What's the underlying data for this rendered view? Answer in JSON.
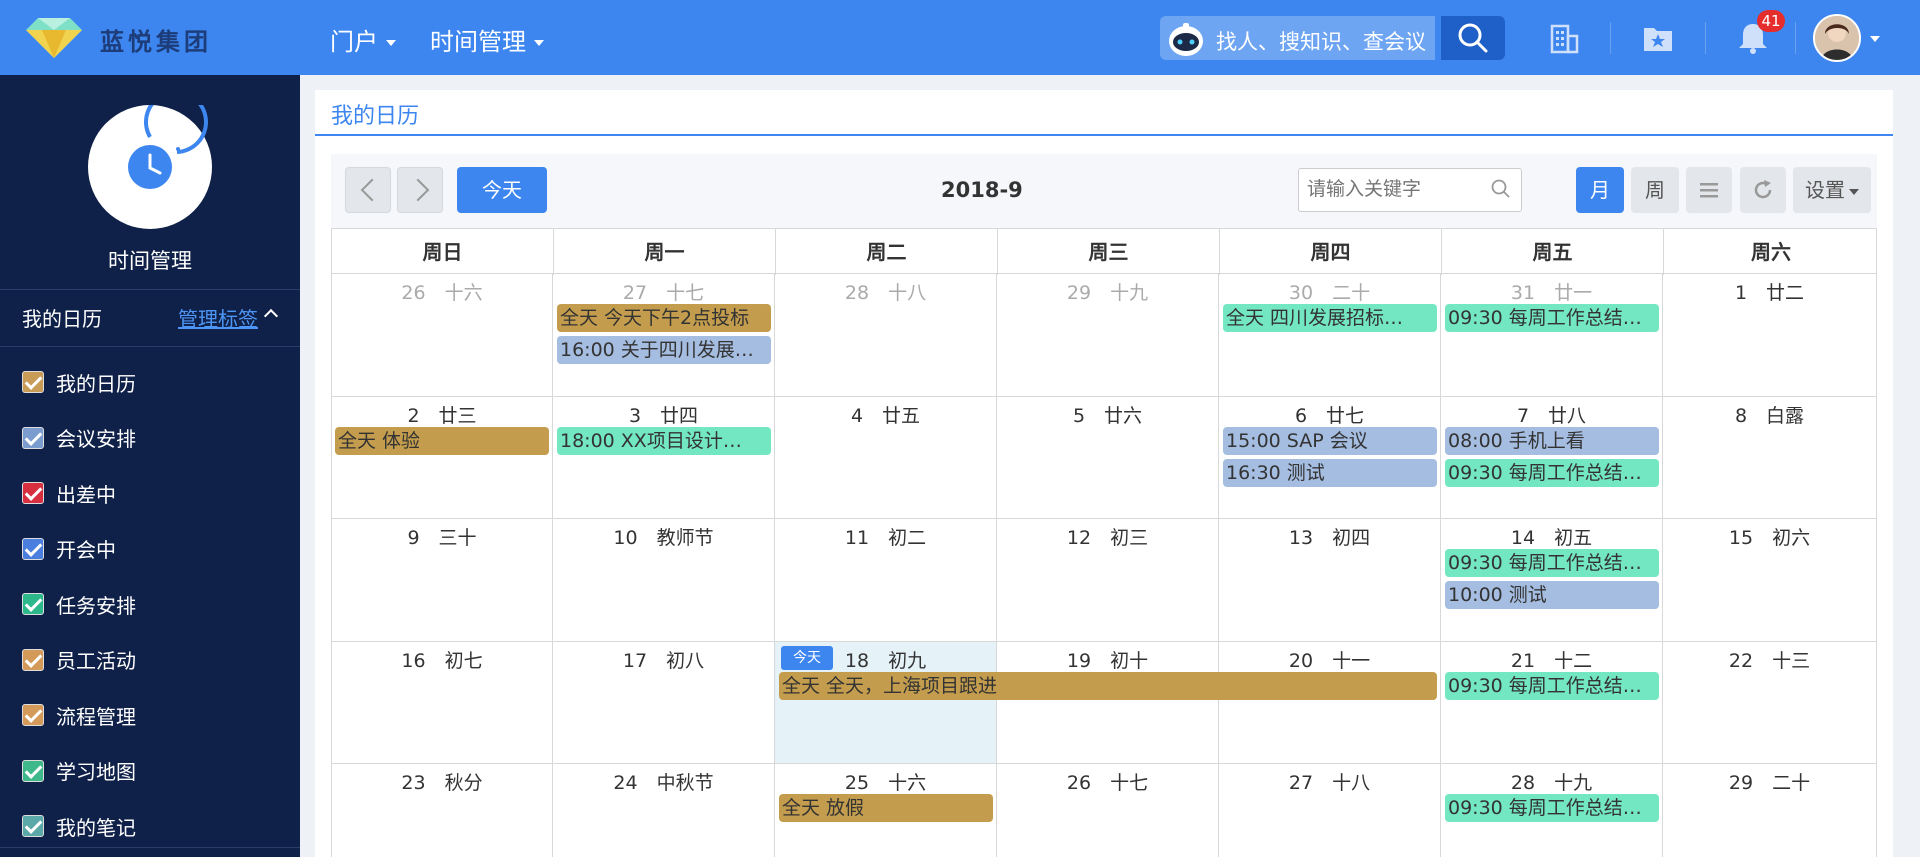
{
  "header": {
    "brand": "蓝悦集团",
    "nav": [
      {
        "label": "门户"
      },
      {
        "label": "时间管理"
      }
    ],
    "search_placeholder": "找人、搜知识、查会议",
    "notification_count": "41",
    "colors": {
      "bar": "#3d86f0",
      "badge": "#e52d2d"
    }
  },
  "sidebar": {
    "title": "时间管理",
    "section_label": "我的日历",
    "manage_label": "管理标签",
    "items": [
      {
        "label": "我的日历",
        "color": "#c89b57"
      },
      {
        "label": "会议安排",
        "color": "#7a9ccf"
      },
      {
        "label": "出差中",
        "color": "#d72f3f"
      },
      {
        "label": "开会中",
        "color": "#4a7fe0"
      },
      {
        "label": "任务安排",
        "color": "#2db88c"
      },
      {
        "label": "员工活动",
        "color": "#d49a5a"
      },
      {
        "label": "流程管理",
        "color": "#d49a5a"
      },
      {
        "label": "学习地图",
        "color": "#3fb98c"
      },
      {
        "label": "我的笔记",
        "color": "#5aa8a8"
      }
    ]
  },
  "panel": {
    "title": "我的日历",
    "today_button": "今天",
    "month": "2018-9",
    "keyword_placeholder": "请输入关键字",
    "views": [
      {
        "label": "月",
        "active": true
      },
      {
        "label": "周"
      },
      {
        "icon": "list-icon"
      },
      {
        "icon": "refresh-icon"
      },
      {
        "label": "设置"
      }
    ]
  },
  "calendar": {
    "weekdays": [
      "周日",
      "周一",
      "周二",
      "周三",
      "周四",
      "周五",
      "周六"
    ],
    "today_tag": "今天",
    "weeks": [
      [
        {
          "label": "26　十六",
          "other": true
        },
        {
          "label": "27　十七",
          "other": true
        },
        {
          "label": "28　十八",
          "other": true
        },
        {
          "label": "29　十九",
          "other": true
        },
        {
          "label": "30　二十",
          "other": true
        },
        {
          "label": "31　廿一",
          "other": true
        },
        {
          "label": "1　廿二"
        }
      ],
      [
        {
          "label": "2　廿三"
        },
        {
          "label": "3　廿四"
        },
        {
          "label": "4　廿五"
        },
        {
          "label": "5　廿六"
        },
        {
          "label": "6　廿七"
        },
        {
          "label": "7　廿八"
        },
        {
          "label": "8　白露"
        }
      ],
      [
        {
          "label": "9　三十"
        },
        {
          "label": "10　教师节"
        },
        {
          "label": "11　初二"
        },
        {
          "label": "12　初三"
        },
        {
          "label": "13　初四"
        },
        {
          "label": "14　初五"
        },
        {
          "label": "15　初六"
        }
      ],
      [
        {
          "label": "16　初七"
        },
        {
          "label": "17　初八"
        },
        {
          "label": "18　初九",
          "today": true
        },
        {
          "label": "19　初十"
        },
        {
          "label": "20　十一"
        },
        {
          "label": "21　十二"
        },
        {
          "label": "22　十三"
        }
      ],
      [
        {
          "label": "23　秋分"
        },
        {
          "label": "24　中秋节"
        },
        {
          "label": "25　十六"
        },
        {
          "label": "26　十七"
        },
        {
          "label": "27　十八"
        },
        {
          "label": "28　十九"
        },
        {
          "label": "29　二十"
        }
      ]
    ],
    "events": [
      {
        "week": 0,
        "start": 1,
        "span": 1,
        "slot": 0,
        "text": "全天 今天下午2点投标",
        "type": "gold"
      },
      {
        "week": 0,
        "start": 1,
        "span": 1,
        "slot": 1,
        "text": "16:00 关于四川发展…",
        "type": "blue"
      },
      {
        "week": 0,
        "start": 4,
        "span": 1,
        "slot": 0,
        "text": "全天 四川发展招标…",
        "type": "green"
      },
      {
        "week": 0,
        "start": 5,
        "span": 1,
        "slot": 0,
        "text": "09:30 每周工作总结…",
        "type": "green"
      },
      {
        "week": 1,
        "start": 0,
        "span": 1,
        "slot": 0,
        "text": "全天 体验",
        "type": "gold"
      },
      {
        "week": 1,
        "start": 1,
        "span": 1,
        "slot": 0,
        "text": "18:00 XX项目设计…",
        "type": "green"
      },
      {
        "week": 1,
        "start": 4,
        "span": 1,
        "slot": 0,
        "text": "15:00 SAP 会议",
        "type": "blue"
      },
      {
        "week": 1,
        "start": 4,
        "span": 1,
        "slot": 1,
        "text": "16:30 测试",
        "type": "blue"
      },
      {
        "week": 1,
        "start": 5,
        "span": 1,
        "slot": 0,
        "text": "08:00 手机上看",
        "type": "blue"
      },
      {
        "week": 1,
        "start": 5,
        "span": 1,
        "slot": 1,
        "text": "09:30 每周工作总结…",
        "type": "green"
      },
      {
        "week": 2,
        "start": 5,
        "span": 1,
        "slot": 0,
        "text": "09:30 每周工作总结…",
        "type": "green"
      },
      {
        "week": 2,
        "start": 5,
        "span": 1,
        "slot": 1,
        "text": "10:00 测试",
        "type": "blue"
      },
      {
        "week": 3,
        "start": 2,
        "span": 3,
        "slot": 0,
        "text": "全天 全天，上海项目跟进",
        "type": "gold"
      },
      {
        "week": 3,
        "start": 5,
        "span": 1,
        "slot": 0,
        "text": "09:30 每周工作总结…",
        "type": "green"
      },
      {
        "week": 4,
        "start": 2,
        "span": 1,
        "slot": 0,
        "text": "全天 放假",
        "type": "gold"
      },
      {
        "week": 4,
        "start": 5,
        "span": 1,
        "slot": 0,
        "text": "09:30 每周工作总结…",
        "type": "green"
      }
    ]
  }
}
